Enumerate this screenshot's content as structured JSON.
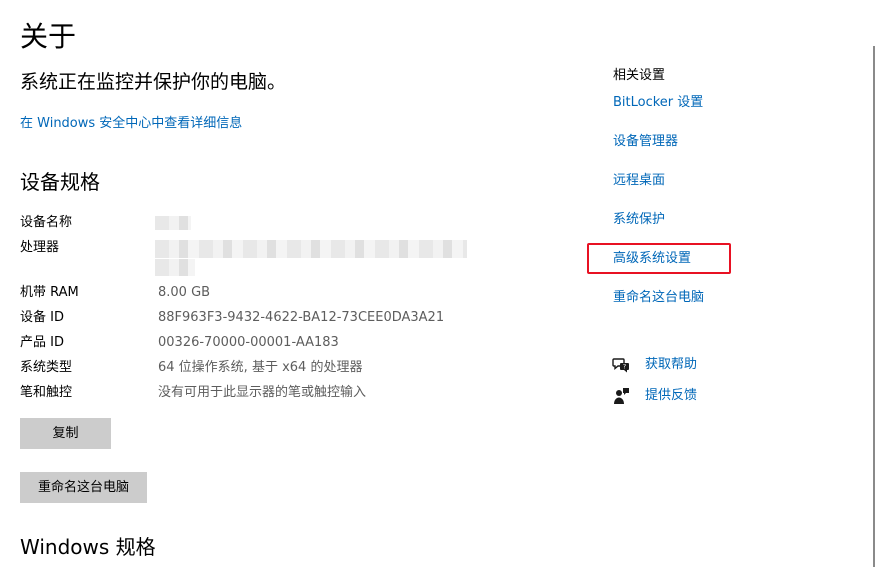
{
  "page": {
    "title": "关于",
    "protect_text": "系统正在监控并保护你的电脑。",
    "security_link": "在 Windows 安全中心中查看详细信息"
  },
  "device_specs": {
    "heading": "设备规格",
    "rows": [
      {
        "label": "设备名称",
        "value": ""
      },
      {
        "label": "处理器",
        "value": ""
      },
      {
        "label": "机带 RAM",
        "value": "8.00 GB"
      },
      {
        "label": "设备 ID",
        "value": "88F963F3-9432-4622-BA12-73CEE0DA3A21"
      },
      {
        "label": "产品 ID",
        "value": "00326-70000-00001-AA183"
      },
      {
        "label": "系统类型",
        "value": "64 位操作系统, 基于 x64 的处理器"
      },
      {
        "label": "笔和触控",
        "value": "没有可用于此显示器的笔或触控输入"
      }
    ],
    "copy_button": "复制",
    "rename_button": "重命名这台电脑"
  },
  "windows_specs": {
    "heading": "Windows 规格"
  },
  "related": {
    "title": "相关设置",
    "links": [
      "BitLocker 设置",
      "设备管理器",
      "远程桌面",
      "系统保护",
      "高级系统设置",
      "重命名这台电脑"
    ],
    "highlighted_link": "高级系统设置",
    "highlight_color": "#e81123"
  },
  "help": {
    "get_help": "获取帮助",
    "get_help_icon": "chat-help-icon",
    "feedback": "提供反馈",
    "feedback_icon": "feedback-person-icon"
  },
  "colors": {
    "link": "#0067b8",
    "button_bg": "#cccccc",
    "value_text": "#5d5d5d"
  }
}
